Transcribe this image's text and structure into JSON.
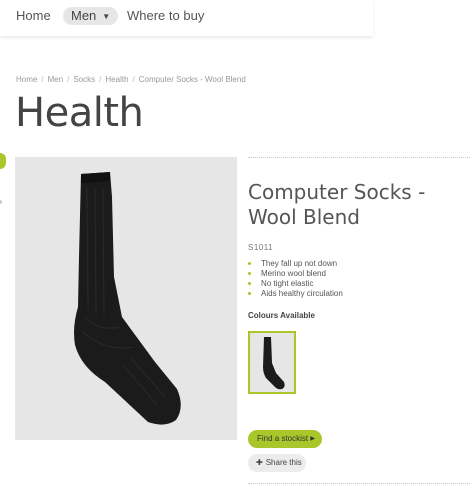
{
  "nav": {
    "home": "Home",
    "men": "Men",
    "men_caret": "▼",
    "where": "Where to buy"
  },
  "breadcrumb": [
    "Home",
    "Men",
    "Socks",
    "Health",
    "Computer Socks - Wool Blend"
  ],
  "breadcrumb_sep": "/",
  "page_title": "Health",
  "product": {
    "name_line1": "Computer Socks -",
    "name_line2": "Wool Blend",
    "sku": "S1011",
    "features": [
      "They fall up not down",
      "Merino wool blend",
      "No tight elastic",
      "Aids healthy circulation"
    ],
    "colours_title": "Colours Available",
    "image_icon": "sock-image",
    "swatch_icon": "sock-swatch-black"
  },
  "actions": {
    "stockist_label": "Find a stockist",
    "stockist_arrow": "▶",
    "share_label": "Share this",
    "share_icon": "✚"
  },
  "colors": {
    "accent": "#a9c72b",
    "image_bg": "#e6e6e6",
    "sock": "#1b1b1b"
  }
}
